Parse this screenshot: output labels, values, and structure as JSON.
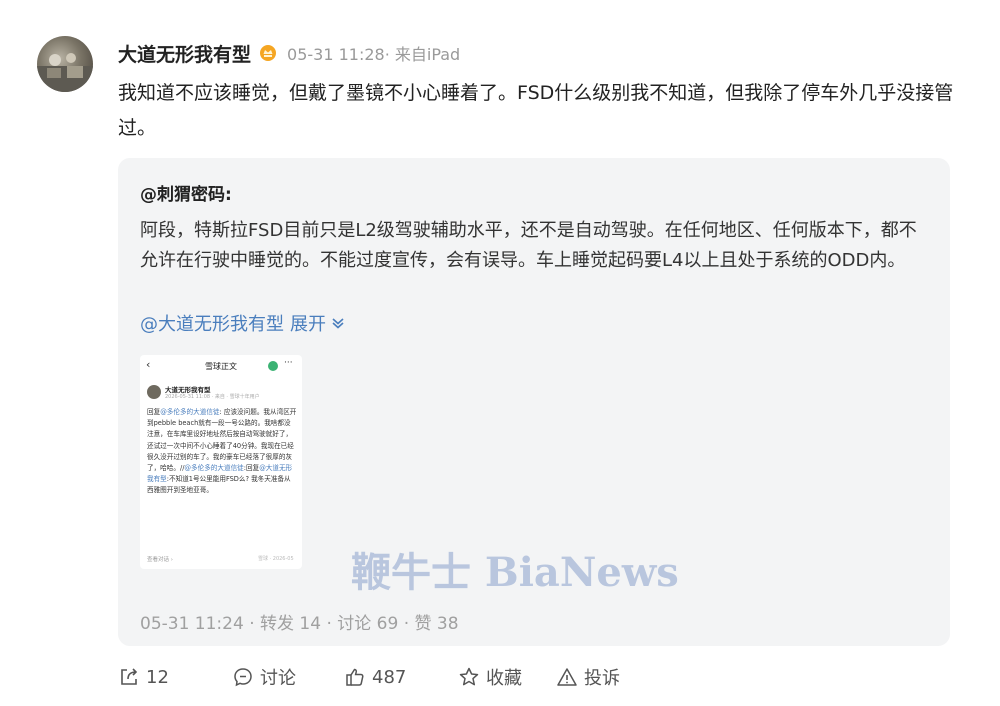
{
  "post": {
    "author": "大道无形我有型",
    "meta": "05-31 11:28· 来自iPad",
    "text": "我知道不应该睡觉，但戴了墨镜不小心睡着了。FSD什么级别我不知道，但我除了停车外几乎没接管过。"
  },
  "quote": {
    "user": "@刺猬密码",
    "user_colon": ":",
    "text": "阿段，特斯拉FSD目前只是L2级驾驶辅助水平，还不是自动驾驶。在任何地区、任何版本下，都不允许在行驶中睡觉的。不能过度宣传，会有误导。车上睡觉起码要L4以上且处于系统的ODD内。",
    "mention": "@大道无形我有型",
    "expand_label": "展开",
    "meta": "05-31 11:24 · 转发 14 · 讨论 69 · 赞 38",
    "thumbnail": {
      "back": "‹",
      "title": "雪球正文",
      "more": "···",
      "author": "大道无形我有型",
      "sub": "2026-05-31 11:08 · 来自 · 雪球十年用户",
      "body_prefix": "回复",
      "link1": "@多伦多的大道信徒",
      "body1": ": 应该没问题。我从湾区开到pebble beach就有一段一号公路的。我啥都没注意，在车库里设好地址然后按自动驾驶就好了，还试过一次中间不小心睡着了40分钟。我现在已经很久没开过别的车了。我的豪车已经落了很厚的灰了，哈哈。//",
      "link2": "@多伦多的大道信徒",
      "body2": ":回复",
      "link3": "@大道无形我有型",
      "body3": ":不知道1号公里能用FSD么? 我冬天准备从西雅图开到圣地亚哥。",
      "footer": "查看对话 ›",
      "footer_right": "雪球 · 2026-05"
    },
    "watermark": "鞭牛士 BiaNews"
  },
  "actions": {
    "repost_count": "12",
    "comment_label": "讨论",
    "like_count": "487",
    "favorite_label": "收藏",
    "report_label": "投诉"
  },
  "colors": {
    "link": "#4a7ebd",
    "card_bg": "#f3f4f5",
    "badge": "#f5a623"
  }
}
